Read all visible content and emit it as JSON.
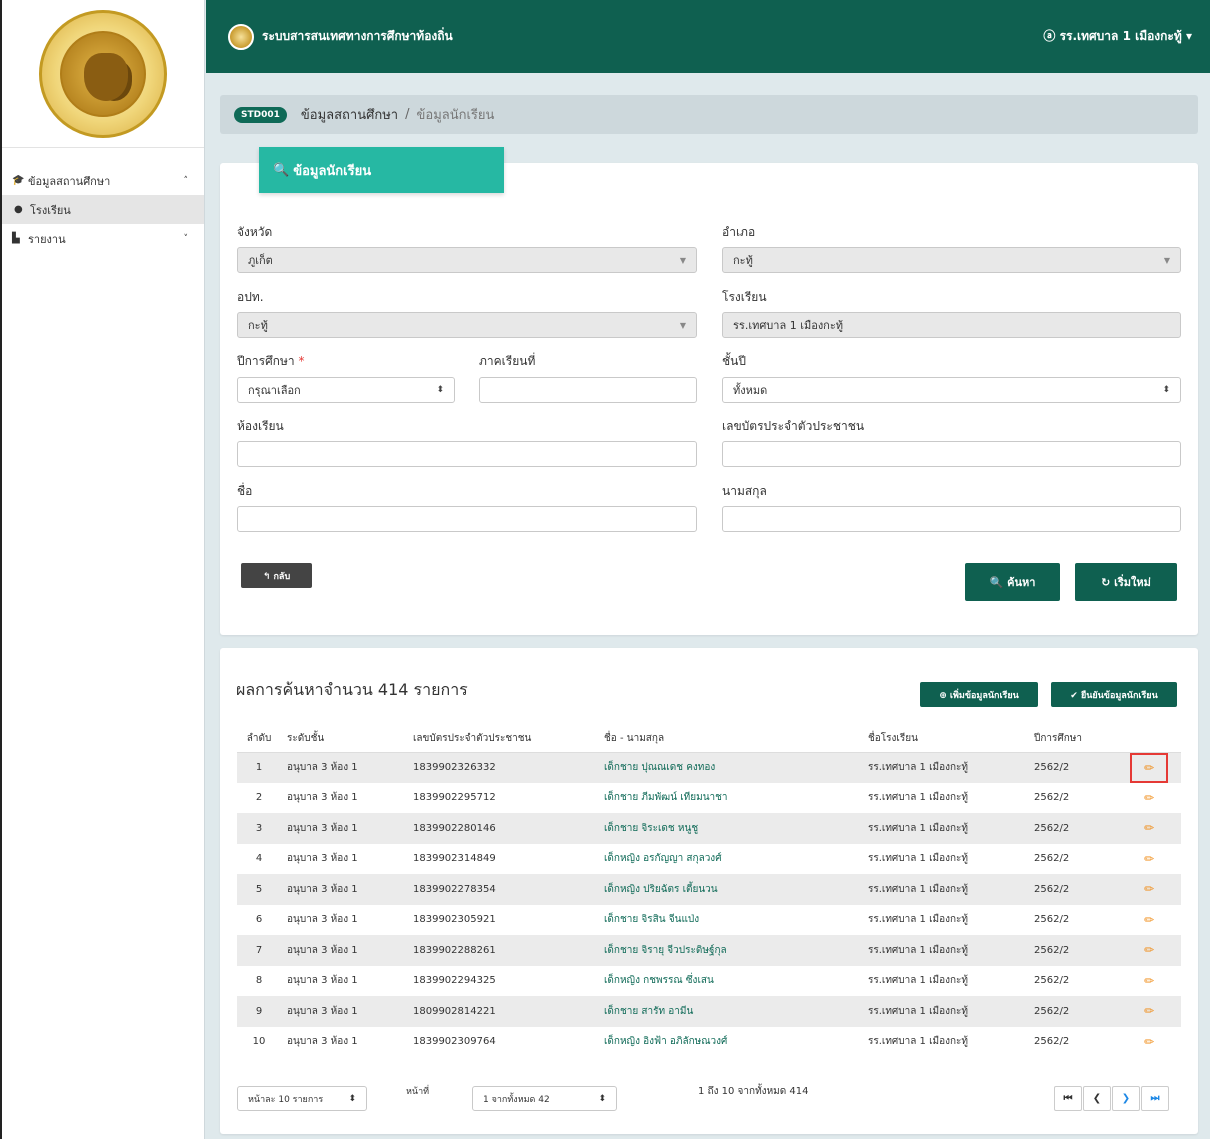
{
  "header": {
    "app_title": "ระบบสารสนเทศทางการศึกษาท้องถิ่น",
    "user_label": "ⓐ รร.เทศบาล 1 เมืองกะทู้ ▾"
  },
  "sidebar": {
    "items": [
      {
        "icon": "graduation-cap-icon",
        "label": "ข้อมูลสถานศึกษา",
        "chevron": "˄"
      },
      {
        "icon": "dot-icon",
        "label": "โรงเรียน"
      },
      {
        "icon": "file-icon",
        "label": "รายงาน",
        "chevron": "˅"
      }
    ]
  },
  "breadcrumb": {
    "badge": "STD001",
    "parent": "ข้อมูลสถานศึกษา",
    "separator": "/",
    "current": "ข้อมูลนักเรียน"
  },
  "search": {
    "tab_title": "ข้อมูลนักเรียน",
    "province_label": "จังหวัด",
    "province_value": "ภูเก็ต",
    "district_label": "อำเภอ",
    "district_value": "กะทู้",
    "lao_label": "อปท.",
    "lao_value": "กะทู้",
    "school_label": "โรงเรียน",
    "school_value": "รร.เทศบาล 1 เมืองกะทู้",
    "year_label": "ปีการศึกษา",
    "year_required": "*",
    "year_value": "กรุณาเลือก",
    "term_label": "ภาคเรียนที่",
    "term_value": "",
    "grade_label": "ชั้นปี",
    "grade_value": "ทั้งหมด",
    "room_label": "ห้องเรียน",
    "room_value": "",
    "id_label": "เลขบัตรประจำตัวประชาชน",
    "id_value": "",
    "fname_label": "ชื่อ",
    "fname_value": "",
    "lname_label": "นามสกุล",
    "lname_value": "",
    "back_label": "↰ กลับ",
    "search_label": "🔍 ค้นหา",
    "reset_label": "↻ เริ่มใหม่"
  },
  "results": {
    "title": "ผลการค้นหาจำนวน 414 รายการ",
    "add_label": "⊕ เพิ่มข้อมูลนักเรียน",
    "confirm_label": "✔ ยืนยันข้อมูลนักเรียน",
    "columns": [
      "ลำดับ",
      "ระดับชั้น",
      "เลขบัตรประจำตัวประชาชน",
      "ชื่อ - นามสกุล",
      "ชื่อโรงเรียน",
      "ปีการศึกษา",
      ""
    ],
    "rows": [
      [
        "1",
        "อนุบาล 3 ห้อง 1",
        "1839902326332",
        "เด็กชาย ปุณณเดช คงทอง",
        "รร.เทศบาล 1 เมืองกะทู้",
        "2562/2"
      ],
      [
        "2",
        "อนุบาล 3 ห้อง 1",
        "1839902295712",
        "เด็กชาย ภีมพัฒน์ เทียมนาชา",
        "รร.เทศบาล 1 เมืองกะทู้",
        "2562/2"
      ],
      [
        "3",
        "อนุบาล 3 ห้อง 1",
        "1839902280146",
        "เด็กชาย จิระเดช หนูชู",
        "รร.เทศบาล 1 เมืองกะทู้",
        "2562/2"
      ],
      [
        "4",
        "อนุบาล 3 ห้อง 1",
        "1839902314849",
        "เด็กหญิง อรกัญญา สกุลวงศ์",
        "รร.เทศบาล 1 เมืองกะทู้",
        "2562/2"
      ],
      [
        "5",
        "อนุบาล 3 ห้อง 1",
        "1839902278354",
        "เด็กหญิง ปริยฉัตร เตี้ยนวน",
        "รร.เทศบาล 1 เมืองกะทู้",
        "2562/2"
      ],
      [
        "6",
        "อนุบาล 3 ห้อง 1",
        "1839902305921",
        "เด็กชาย จิรสิน จีนแป่ง",
        "รร.เทศบาล 1 เมืองกะทู้",
        "2562/2"
      ],
      [
        "7",
        "อนุบาล 3 ห้อง 1",
        "1839902288261",
        "เด็กชาย จิรายุ จีวประดิษฐ์กุล",
        "รร.เทศบาล 1 เมืองกะทู้",
        "2562/2"
      ],
      [
        "8",
        "อนุบาล 3 ห้อง 1",
        "1839902294325",
        "เด็กหญิง กชพรรณ ซึ่งเสน",
        "รร.เทศบาล 1 เมืองกะทู้",
        "2562/2"
      ],
      [
        "9",
        "อนุบาล 3 ห้อง 1",
        "1809902814221",
        "เด็กชาย สารัท อามีน",
        "รร.เทศบาล 1 เมืองกะทู้",
        "2562/2"
      ],
      [
        "10",
        "อนุบาล 3 ห้อง 1",
        "1839902309764",
        "เด็กหญิง อิงฟ้า อภิลักษณวงศ์",
        "รร.เทศบาล 1 เมืองกะทู้",
        "2562/2"
      ]
    ],
    "per_page_value": "หน้าละ 10 รายการ",
    "page_label": "หน้าที่",
    "page_value": "1 จากทั้งหมด 42",
    "range_info": "1 ถึง 10 จากทั้งหมด 414",
    "pager_first": "⏮",
    "pager_prev": "❮",
    "pager_next": "❯",
    "pager_last": "⏭"
  },
  "colors": {
    "header_bg": "#0f6050",
    "tab_bg": "#26b8a3",
    "edit_icon": "#f08a12",
    "highlight": "#e53935"
  }
}
